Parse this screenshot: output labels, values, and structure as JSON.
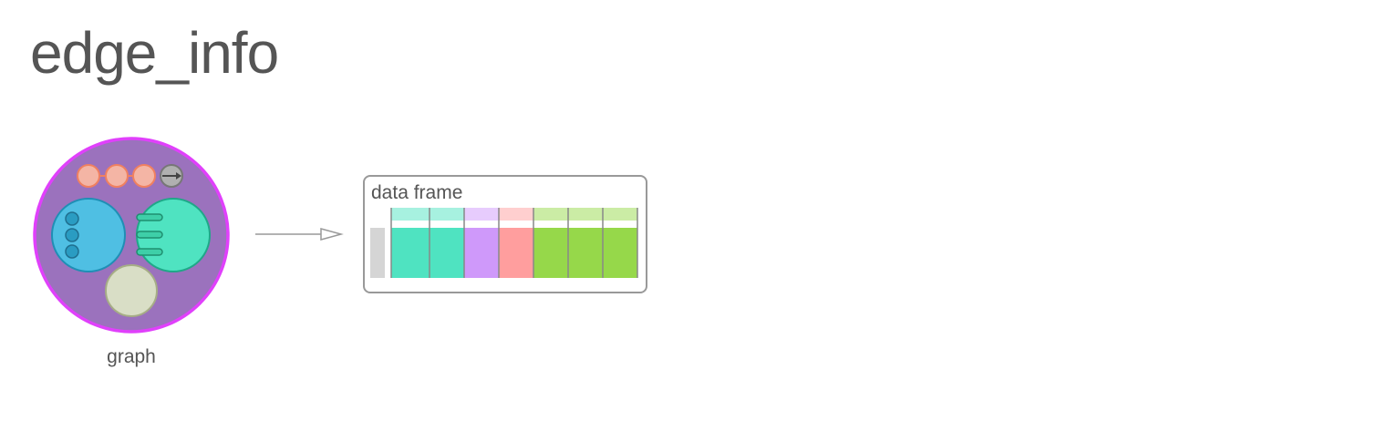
{
  "page": {
    "title": "edge_info"
  },
  "input": {
    "label": "graph",
    "icon": "graph-icon",
    "colors": {
      "outer_fill": "#9b72bd",
      "outer_ring": "#e040fb",
      "nodes_circle": "#4fbfe3",
      "edges_circle": "#4fe3c1",
      "bottom_circle": "#d9dec6",
      "top_dots": "#f4b5a5",
      "top_arrow": "#b0b0b0"
    }
  },
  "connector": {
    "icon": "arrow-right-icon",
    "color": "#999999"
  },
  "output": {
    "label": "data frame",
    "icon": "data-frame-icon",
    "colors": {
      "border": "#999999",
      "row_names": "#d5d5d5",
      "columns": [
        {
          "body": "#4fe3c1",
          "header": "#a7f1e0"
        },
        {
          "body": "#4fe3c1",
          "header": "#a7f1e0"
        },
        {
          "body": "#cf99fa",
          "header": "#e7ccfd"
        },
        {
          "body": "#ff9e9e",
          "header": "#ffcfcf"
        },
        {
          "body": "#96d84a",
          "header": "#cbeca5"
        },
        {
          "body": "#96d84a",
          "header": "#cbeca5"
        },
        {
          "body": "#96d84a",
          "header": "#cbeca5"
        }
      ]
    }
  }
}
